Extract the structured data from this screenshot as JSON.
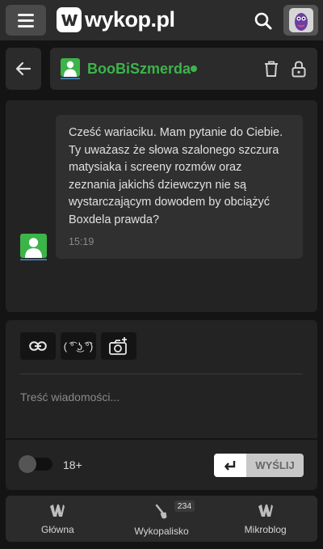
{
  "header": {
    "logo_text": "wykop.pl",
    "menu_icon": "hamburger-icon",
    "search_icon": "search-icon"
  },
  "conversation": {
    "username": "BooBiSzmerda",
    "status": "online",
    "username_color": "#3cb44a"
  },
  "message": {
    "text": "Cześć wariaciku. Mam pytanie do Ciebie. Ty uważasz że słowa szalonego szczura matysiaka i screeny rozmów oraz zeznania jakichś dziewczyn nie są wystarczającym dowodem by obciążyć Boxdela prawda?",
    "time": "15:19"
  },
  "composer": {
    "link_icon": "link-icon",
    "lenny_label": "( ͡° ͜ʖ ͡°)",
    "photo_icon": "add-photo-icon",
    "placeholder": "Treść wiadomości...",
    "adult_label": "18+",
    "adult_enabled": false,
    "send_label": "WYŚLIJ"
  },
  "nav": {
    "items": [
      {
        "label": "Główna",
        "icon": "home-logo-icon"
      },
      {
        "label": "Wykopalisko",
        "icon": "shovel-icon",
        "badge": "234"
      },
      {
        "label": "Mikroblog",
        "icon": "mikroblog-logo-icon"
      }
    ]
  }
}
